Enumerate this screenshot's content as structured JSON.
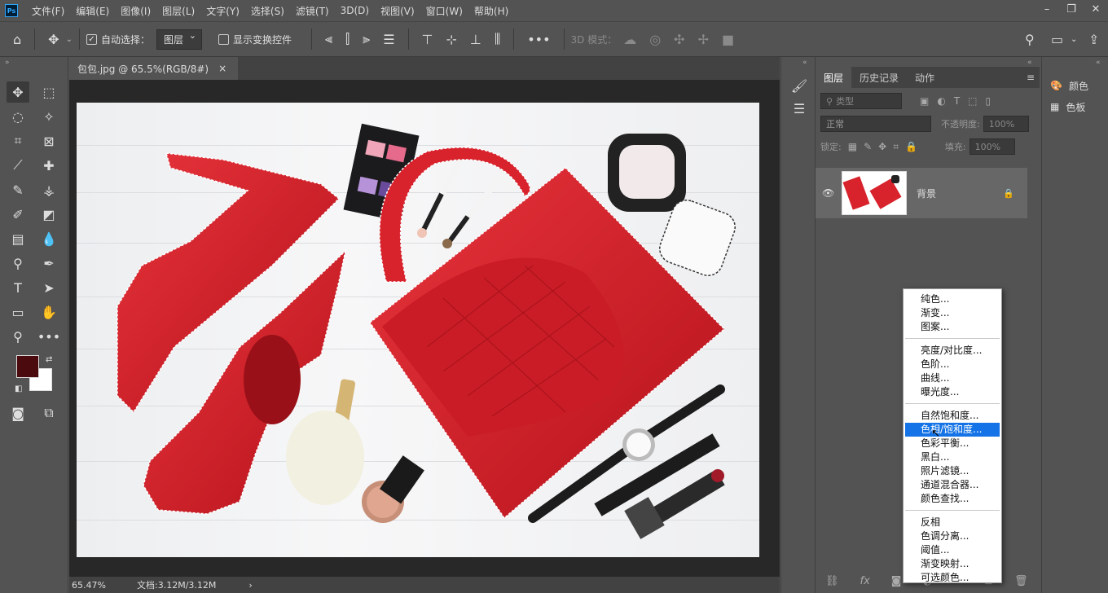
{
  "app": {
    "logo": "Ps"
  },
  "menubar": {
    "items": [
      "文件(F)",
      "编辑(E)",
      "图像(I)",
      "图层(L)",
      "文字(Y)",
      "选择(S)",
      "滤镜(T)",
      "3D(D)",
      "视图(V)",
      "窗口(W)",
      "帮助(H)"
    ]
  },
  "window_controls": {
    "minimize": "–",
    "restore": "❐",
    "close": "✕"
  },
  "options_bar": {
    "auto_select_label": "自动选择：",
    "auto_select_target": "图层",
    "show_transform_label": "显示变换控件",
    "mode_3d_label": "3D 模式："
  },
  "document": {
    "tab_title": "包包.jpg @ 65.5%(RGB/8#)",
    "close": "×"
  },
  "status_bar": {
    "zoom": "65.47%",
    "doc_info": "文档:3.12M/3.12M"
  },
  "colors": {
    "foreground": "#4a0a0e",
    "background": "#ffffff",
    "accent": "#1473e6",
    "bag_red": "#d8222c"
  },
  "layers_panel": {
    "tabs": [
      "图层",
      "历史记录",
      "动作"
    ],
    "filter_kind": "类型",
    "blend_mode": "正常",
    "opacity_label": "不透明度:",
    "opacity_value": "100%",
    "lock_label": "锁定:",
    "fill_label": "填充:",
    "fill_value": "100%",
    "layers": [
      {
        "name": "背景",
        "locked": true,
        "visible": true
      }
    ]
  },
  "right_panel": {
    "items": [
      "颜色",
      "色板"
    ]
  },
  "adjustment_menu": {
    "groups": [
      [
        "纯色...",
        "渐变...",
        "图案..."
      ],
      [
        "亮度/对比度...",
        "色阶...",
        "曲线...",
        "曝光度..."
      ],
      [
        "自然饱和度...",
        "色相/饱和度...",
        "色彩平衡...",
        "黑白...",
        "照片滤镜...",
        "通道混合器...",
        "颜色查找..."
      ],
      [
        "反相",
        "色调分离...",
        "阈值...",
        "渐变映射...",
        "可选颜色..."
      ]
    ],
    "highlighted": "色相/饱和度..."
  }
}
